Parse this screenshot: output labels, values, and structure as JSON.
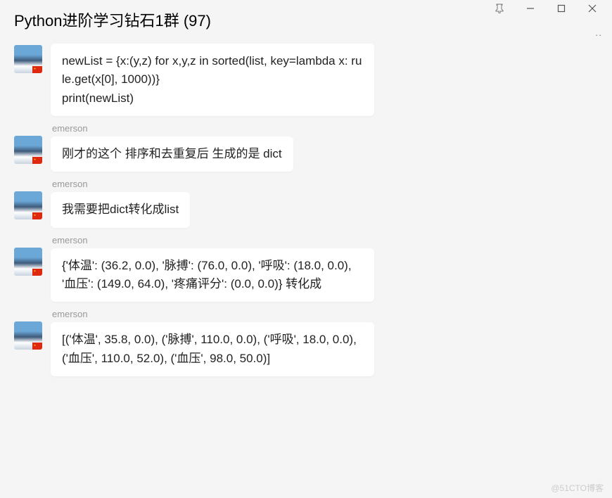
{
  "header": {
    "title": "Python进阶学习钻石1群 (97)"
  },
  "messages": [
    {
      "sender": "",
      "text": "newList = {x:(y,z) for x,y,z in sorted(list, key=lambda x: rule.get(x[0], 1000))}\nprint(newList)"
    },
    {
      "sender": "emerson",
      "text": "刚才的这个 排序和去重复后 生成的是 dict"
    },
    {
      "sender": "emerson",
      "text": "我需要把dict转化成list"
    },
    {
      "sender": "emerson",
      "text": "{'体温': (36.2, 0.0), '脉搏': (76.0, 0.0), '呼吸': (18.0, 0.0), '血压': (149.0, 64.0), '疼痛评分': (0.0, 0.0)}  转化成"
    },
    {
      "sender": "emerson",
      "text": "  [('体温', 35.8, 0.0), ('脉搏', 110.0, 0.0), ('呼吸', 18.0, 0.0), ('血压', 110.0, 52.0), ('血压', 98.0, 50.0)]"
    }
  ],
  "watermark": "@51CTO博客"
}
